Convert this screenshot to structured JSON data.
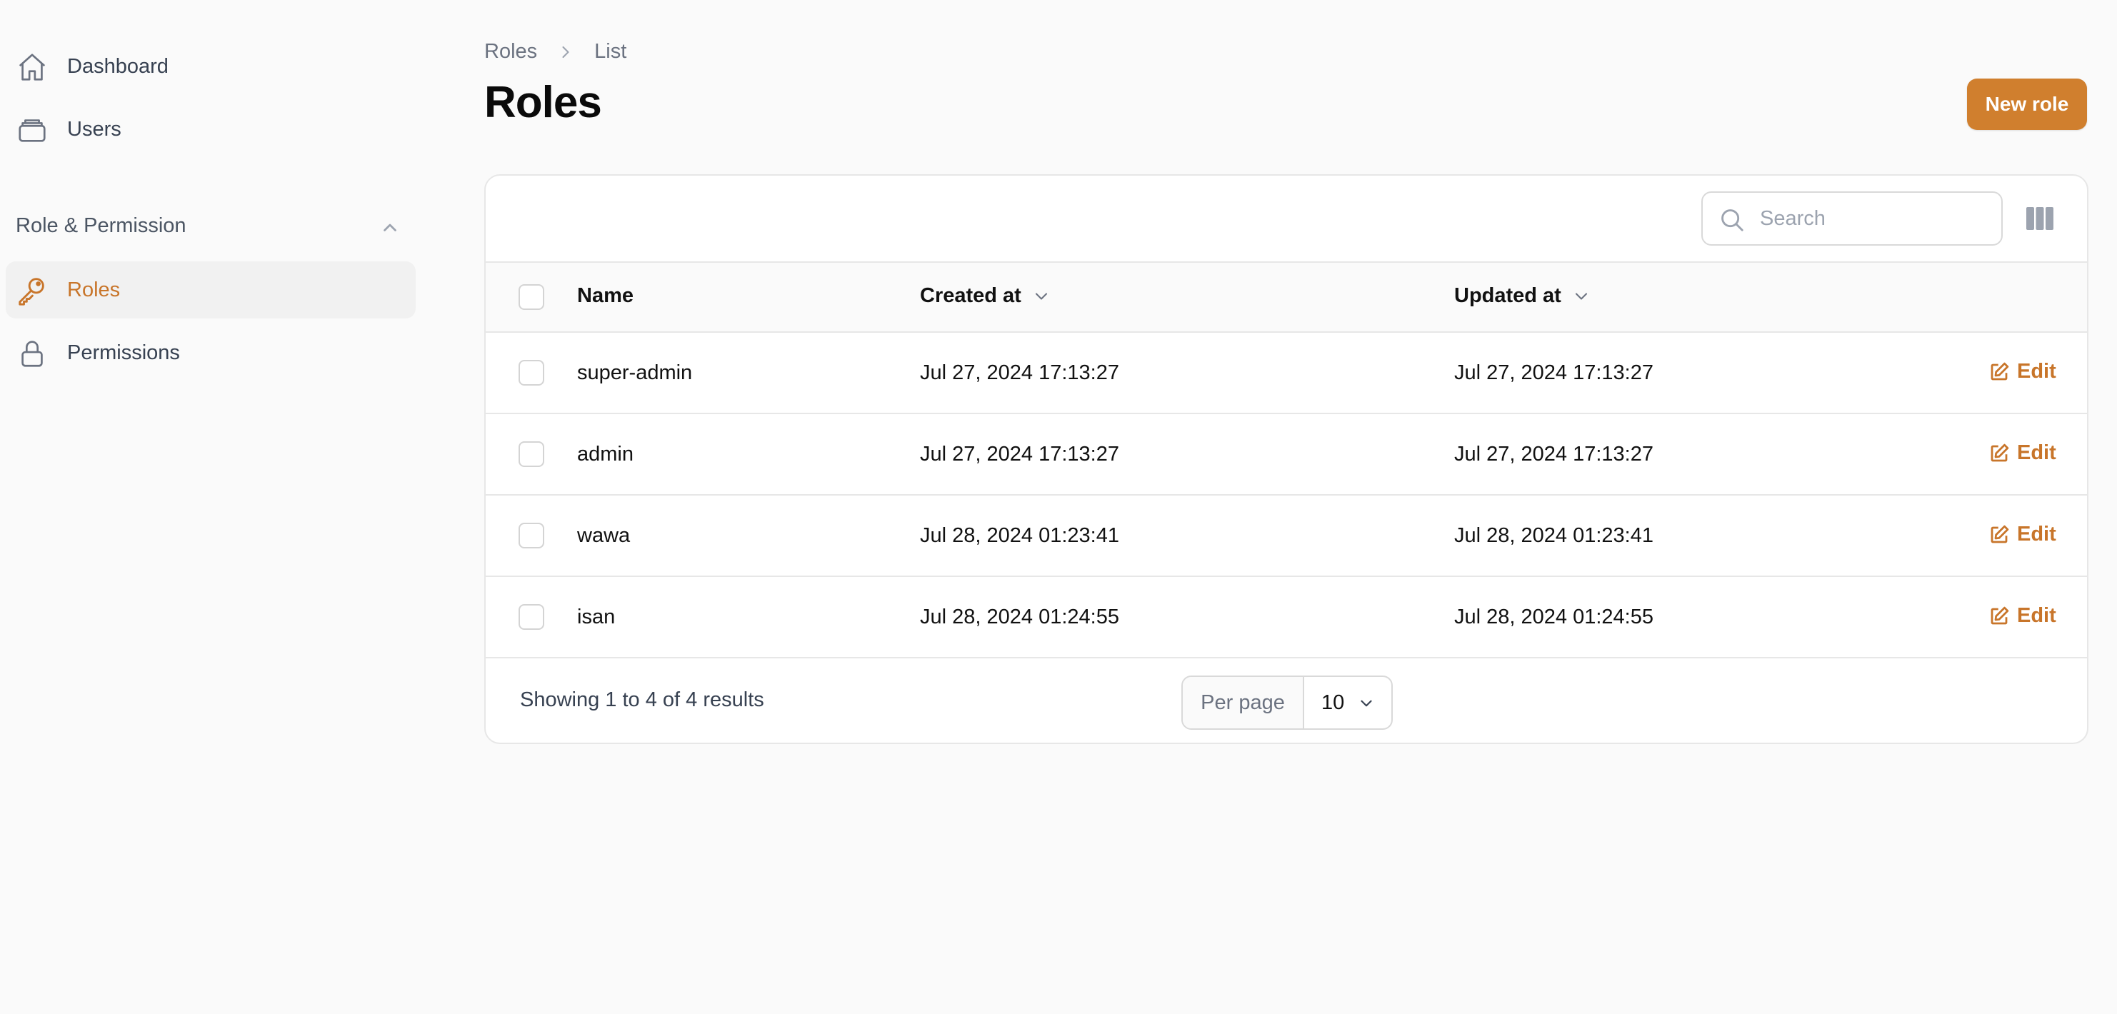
{
  "sidebar": {
    "items": [
      {
        "label": "Dashboard",
        "icon": "home-icon"
      },
      {
        "label": "Users",
        "icon": "users-stack-icon"
      }
    ],
    "group": {
      "label": "Role & Permission",
      "items": [
        {
          "label": "Roles",
          "icon": "key-icon",
          "active": true
        },
        {
          "label": "Permissions",
          "icon": "lock-icon",
          "active": false
        }
      ]
    }
  },
  "breadcrumb": [
    "Roles",
    "List"
  ],
  "page": {
    "title": "Roles",
    "new_button": "New role"
  },
  "table": {
    "search_placeholder": "Search",
    "columns": [
      "Name",
      "Created at",
      "Updated at"
    ],
    "rows": [
      {
        "name": "super-admin",
        "created": "Jul 27, 2024 17:13:27",
        "updated": "Jul 27, 2024 17:13:27",
        "action": "Edit"
      },
      {
        "name": "admin",
        "created": "Jul 27, 2024 17:13:27",
        "updated": "Jul 27, 2024 17:13:27",
        "action": "Edit"
      },
      {
        "name": "wawa",
        "created": "Jul 28, 2024 01:23:41",
        "updated": "Jul 28, 2024 01:23:41",
        "action": "Edit"
      },
      {
        "name": "isan",
        "created": "Jul 28, 2024 01:24:55",
        "updated": "Jul 28, 2024 01:24:55",
        "action": "Edit"
      }
    ],
    "summary": "Showing 1 to 4 of 4 results",
    "per_page_label": "Per page",
    "per_page_value": "10"
  },
  "colors": {
    "accent": "#d07f2e",
    "accent_text": "#c8752a"
  }
}
